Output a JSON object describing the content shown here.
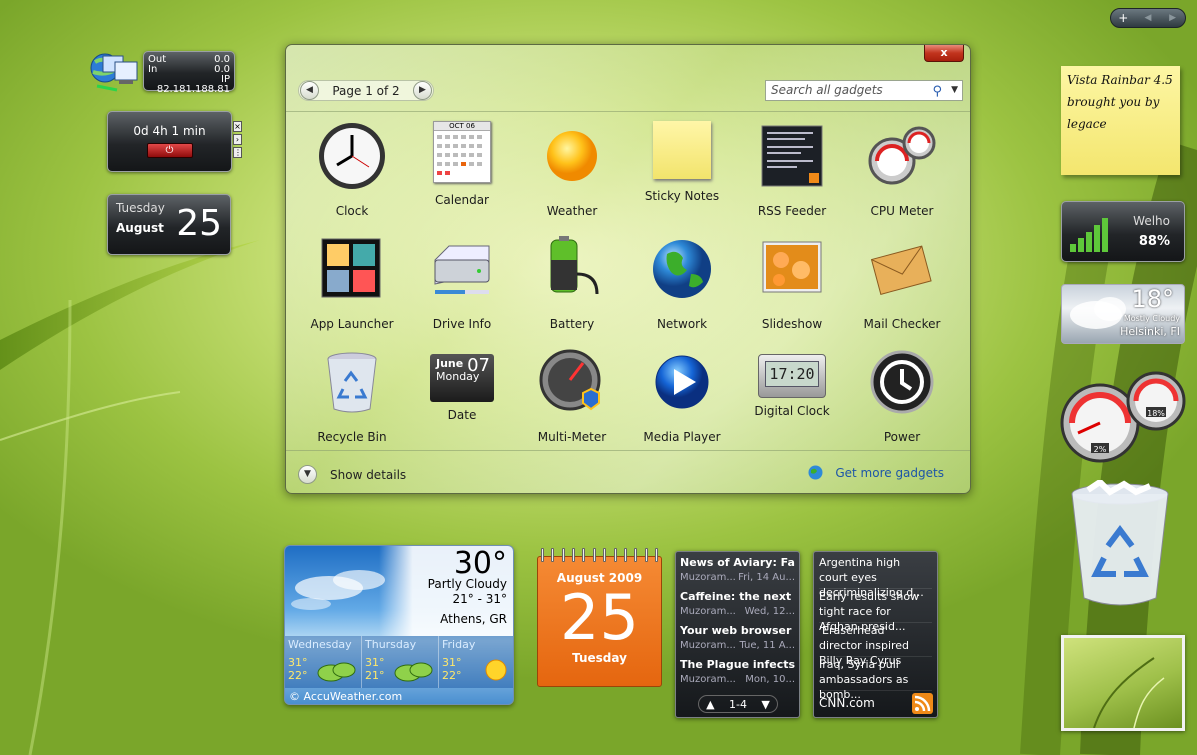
{
  "sidebar_bar": {
    "add": "+",
    "prev": "◀",
    "next": "▶"
  },
  "network_meter": {
    "out_label": "Out",
    "out_value": "0.0",
    "in_label": "In",
    "in_value": "0.0",
    "ip": "IP 82.181.188.81"
  },
  "uptime": {
    "value": "0d 4h 1 min"
  },
  "date_widget": {
    "weekday": "Tuesday",
    "month": "August",
    "day": "25"
  },
  "gallery": {
    "close_label": "x",
    "page_label": "Page 1 of 2",
    "search_placeholder": "Search all gadgets",
    "items": [
      {
        "label": "Clock"
      },
      {
        "label": "Calendar"
      },
      {
        "label": "Weather"
      },
      {
        "label": "Sticky Notes"
      },
      {
        "label": "RSS Feeder"
      },
      {
        "label": "CPU Meter"
      },
      {
        "label": "App Launcher"
      },
      {
        "label": "Drive Info"
      },
      {
        "label": "Battery"
      },
      {
        "label": "Network"
      },
      {
        "label": "Slideshow"
      },
      {
        "label": "Mail Checker"
      },
      {
        "label": "Recycle Bin"
      },
      {
        "label": "Date"
      },
      {
        "label": "Multi-Meter"
      },
      {
        "label": "Media Player"
      },
      {
        "label": "Digital Clock"
      },
      {
        "label": "Power"
      }
    ],
    "calendar_icon_month": "OCT 06",
    "date_icon": {
      "month": "June",
      "day": "07",
      "weekday": "Monday"
    },
    "digital_clock_icon": "17:20",
    "show_details": "Show details",
    "get_more": "Get more gadgets"
  },
  "sticky_note": {
    "text": "Vista Rainbar 4.5 brought you by legace"
  },
  "wifi": {
    "name": "Welho",
    "percent": "88%"
  },
  "small_weather": {
    "temp": "18°",
    "condition": "Mostly Cloudy",
    "city": "Helsinki, FI"
  },
  "cpu_meter": {
    "cpu": "2%",
    "ram": "18%"
  },
  "weather": {
    "temp": "30°",
    "condition": "Partly Cloudy",
    "range": "21° - 31°",
    "city": "Athens, GR",
    "forecast": [
      {
        "day": "Wednesday",
        "hi": "31°",
        "lo": "22°",
        "icon": "partly-cloudy-icon"
      },
      {
        "day": "Thursday",
        "hi": "31°",
        "lo": "21°",
        "icon": "partly-cloudy-icon"
      },
      {
        "day": "Friday",
        "hi": "31°",
        "lo": "22°",
        "icon": "sunny-icon"
      }
    ],
    "credit": "© AccuWeather.com"
  },
  "calendar": {
    "month": "August 2009",
    "day": "25",
    "weekday": "Tuesday"
  },
  "rss": {
    "items": [
      {
        "title": "News of Aviary: Falc...",
        "source": "Muzoram...",
        "date": "Fri, 14 Au..."
      },
      {
        "title": "Caffeine: the next se...",
        "source": "Muzoram...",
        "date": "Wed, 12..."
      },
      {
        "title": "Your web browser li...",
        "source": "Muzoram...",
        "date": "Tue, 11 A..."
      },
      {
        "title": "The Plague infects Cr...",
        "source": "Muzoram...",
        "date": "Mon, 10..."
      }
    ],
    "pager": "1-4"
  },
  "cnn": {
    "items": [
      {
        "text": "Argentina high court eyes decriminalizing d..."
      },
      {
        "text": "Early results show tight race for Afghan presid..."
      },
      {
        "text": "'Eraserhead' director inspired Billy Ray Cyrus"
      },
      {
        "text": "Iraq, Syria pull ambassadors as bomb..."
      }
    ],
    "source": "CNN.com"
  }
}
